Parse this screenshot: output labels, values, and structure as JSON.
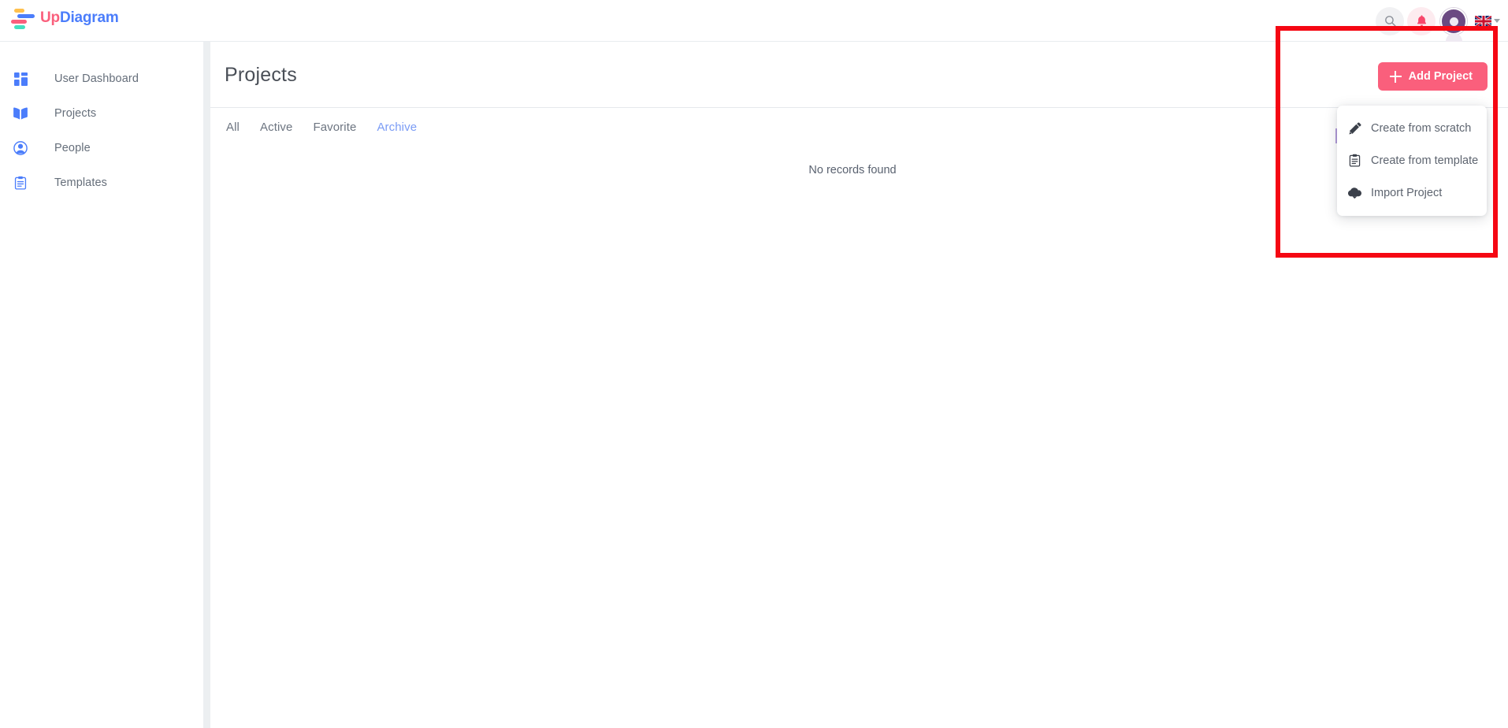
{
  "app": {
    "brand_first": "Up",
    "brand_second": "Diagram",
    "logo_colors": {
      "yellow": "#ffc04d",
      "blue": "#4b7dfb",
      "pink": "#fa5f7c",
      "teal": "#43e0c0"
    }
  },
  "topbar": {
    "search_icon": "search-icon",
    "notification_icon": "bell-icon",
    "avatar_icon": "user-avatar",
    "language_flag": "uk-flag",
    "language_caret": "chevron-down-icon"
  },
  "sidebar": {
    "items": [
      {
        "label": "User Dashboard",
        "icon": "dashboard-grid-icon",
        "active": false
      },
      {
        "label": "Projects",
        "icon": "book-icon",
        "active": false
      },
      {
        "label": "People",
        "icon": "person-circle-icon",
        "active": false
      },
      {
        "label": "Templates",
        "icon": "clipboard-icon",
        "active": false
      }
    ]
  },
  "main": {
    "page_title": "Projects",
    "add_button": {
      "label": "Add Project",
      "icon": "plus-icon",
      "color": "#fa5f7c"
    },
    "tabs": [
      {
        "label": "All",
        "active": false
      },
      {
        "label": "Active",
        "active": false
      },
      {
        "label": "Favorite",
        "active": false
      },
      {
        "label": "Archive",
        "active": true
      }
    ],
    "active_tab_color": "#7b9cf5",
    "empty_message": "No records found"
  },
  "dropdown": {
    "open": true,
    "items": [
      {
        "label": "Create from scratch",
        "icon": "pencil-icon"
      },
      {
        "label": "Create from template",
        "icon": "clipboard-icon"
      },
      {
        "label": "Import Project",
        "icon": "cloud-download-icon"
      }
    ]
  },
  "annotation": {
    "type": "highlight-rectangle",
    "color": "#f50713"
  }
}
